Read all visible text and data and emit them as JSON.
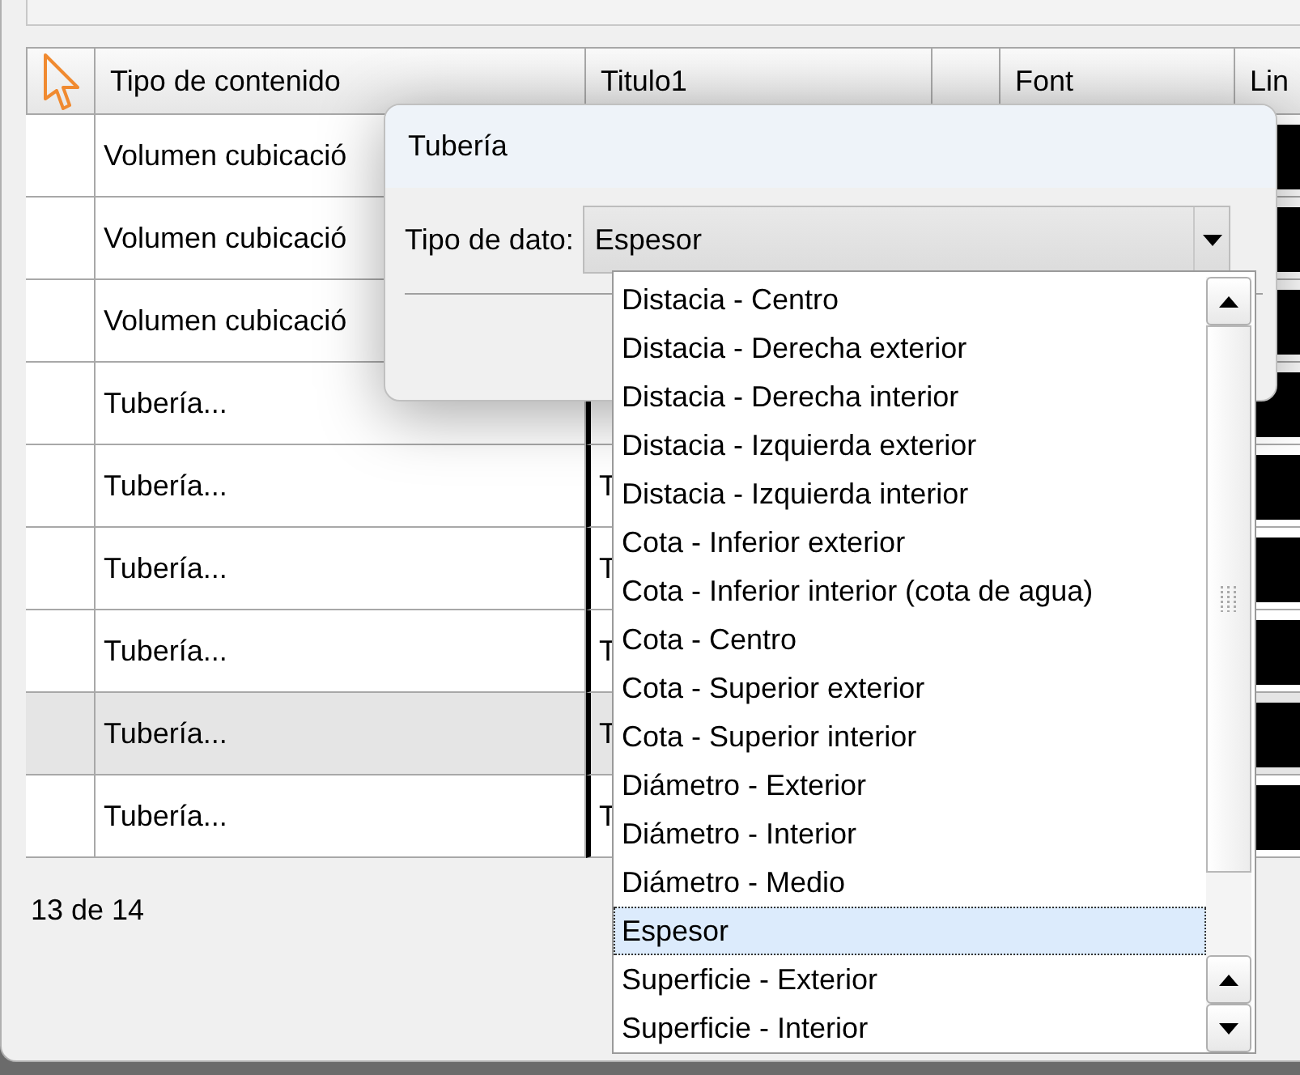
{
  "table": {
    "columns": [
      {
        "label": "Tipo de contenido"
      },
      {
        "label": "Titulo1"
      },
      {},
      {
        "label": "Font"
      },
      {
        "label": "Lin"
      }
    ],
    "rows": [
      {
        "tipo": "Volumen cubicació",
        "selected": false
      },
      {
        "tipo": "Volumen cubicació",
        "selected": false
      },
      {
        "tipo": "Volumen cubicació",
        "selected": false
      },
      {
        "tipo": "Tubería...",
        "selected": false
      },
      {
        "tipo": "Tubería...",
        "titulo": "T",
        "selected": false
      },
      {
        "tipo": "Tubería...",
        "titulo": "T",
        "selected": false
      },
      {
        "tipo": "Tubería...",
        "titulo": "T",
        "selected": false
      },
      {
        "tipo": "Tubería...",
        "titulo": "T",
        "selected": true
      },
      {
        "tipo": "Tubería...",
        "titulo": "T",
        "selected": false
      }
    ]
  },
  "status": "13 de 14",
  "dialog": {
    "title": "Tubería",
    "field_label": "Tipo de dato:",
    "value": "Espesor",
    "options": [
      {
        "label": "Distacia - Centro",
        "selected": false
      },
      {
        "label": "Distacia - Derecha exterior",
        "selected": false
      },
      {
        "label": "Distacia - Derecha interior",
        "selected": false
      },
      {
        "label": "Distacia - Izquierda exterior",
        "selected": false
      },
      {
        "label": "Distacia - Izquierda interior",
        "selected": false
      },
      {
        "label": "Cota - Inferior exterior",
        "selected": false
      },
      {
        "label": "Cota - Inferior interior (cota de agua)",
        "selected": false
      },
      {
        "label": "Cota - Centro",
        "selected": false
      },
      {
        "label": "Cota - Superior exterior",
        "selected": false
      },
      {
        "label": "Cota - Superior interior",
        "selected": false
      },
      {
        "label": "Diámetro - Exterior",
        "selected": false
      },
      {
        "label": "Diámetro - Interior",
        "selected": false
      },
      {
        "label": "Diámetro - Medio",
        "selected": false
      },
      {
        "label": "Espesor",
        "selected": true
      },
      {
        "label": "Superficie - Exterior",
        "selected": false
      },
      {
        "label": "Superficie - Interior",
        "selected": false
      }
    ]
  }
}
